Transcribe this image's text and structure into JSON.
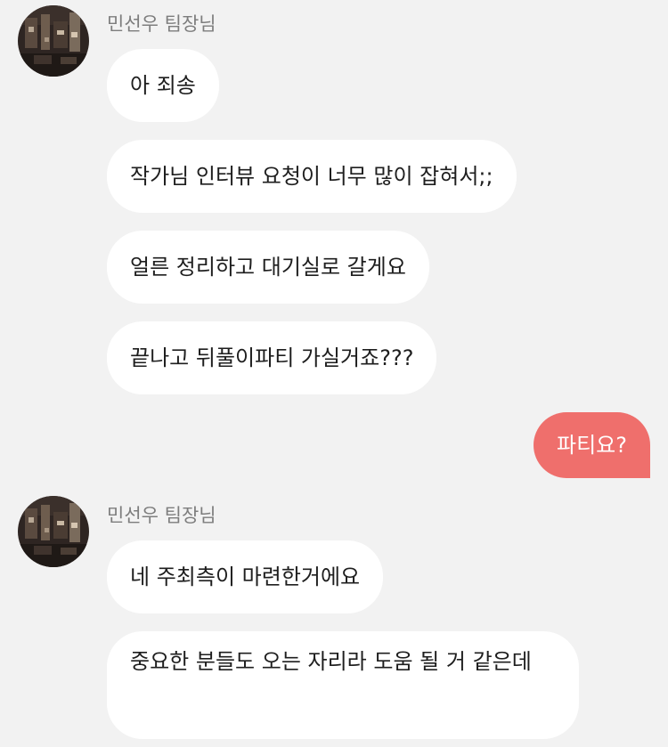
{
  "groups": [
    {
      "sender": "민선우 팀장님",
      "messages": [
        "아 죄송",
        "작가님 인터뷰 요청이 너무 많이 잡혀서;;",
        "얼른 정리하고 대기실로 갈게요",
        "끝나고 뒤풀이파티 가실거죠???"
      ]
    },
    {
      "sender": "민선우 팀장님",
      "messages": [
        "네 주최측이 마련한거에요",
        "중요한 분들도 오는 자리라 도움 될 거 같은데"
      ]
    }
  ],
  "my_messages": [
    "파티요?"
  ],
  "colors": {
    "background": "#f2f2f2",
    "incoming_bubble": "#ffffff",
    "outgoing_bubble": "#ef6f6c",
    "sender_name": "#7d7d7d"
  },
  "icons": {
    "avatar": "profile-photo-avatar"
  }
}
